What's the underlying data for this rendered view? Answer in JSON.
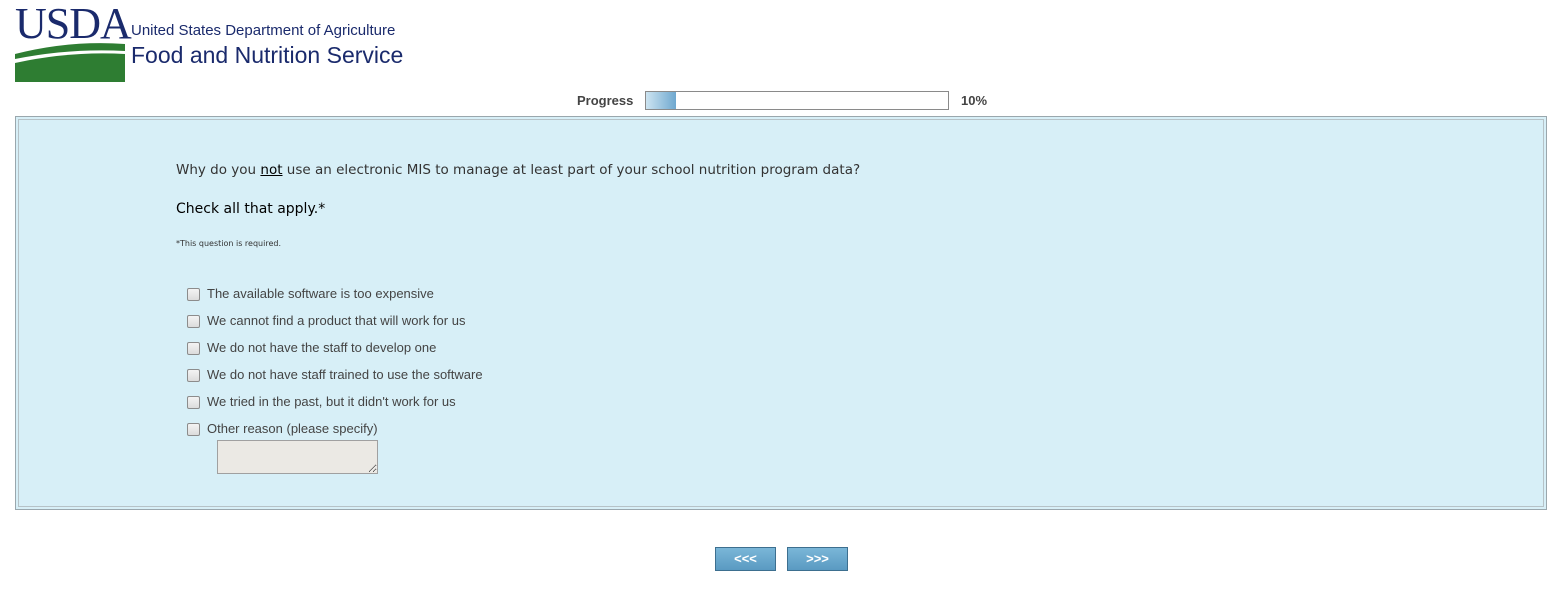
{
  "header": {
    "logo_text": "USDA",
    "agency_line1": "United States Department of Agriculture",
    "agency_line2": "Food and Nutrition Service"
  },
  "progress": {
    "label": "Progress",
    "value_percent": 10,
    "percent_label": "10%"
  },
  "question": {
    "text_before": "Why do you ",
    "text_emphasis": "not",
    "text_after": " use an electronic MIS to manage at least part of your school nutrition program data?",
    "instruction": "Check all that apply.*",
    "required_note": "*This question is required."
  },
  "options": [
    {
      "label": "The available software is too expensive",
      "checked": false
    },
    {
      "label": "We cannot find a product that will work for us",
      "checked": false
    },
    {
      "label": "We do not have the staff to develop one",
      "checked": false
    },
    {
      "label": "We do not have staff trained to use the software",
      "checked": false
    },
    {
      "label": "We tried in the past, but it didn't work for us",
      "checked": false
    },
    {
      "label": "Other reason (please specify)",
      "checked": false
    }
  ],
  "other_text": {
    "value": ""
  },
  "nav": {
    "prev_label": "<<<",
    "next_label": ">>>"
  },
  "colors": {
    "brand_navy": "#1a2a6c",
    "brand_green": "#2e7d32",
    "panel_bg": "#d7eff7",
    "button_blue": "#5a9ac2"
  }
}
